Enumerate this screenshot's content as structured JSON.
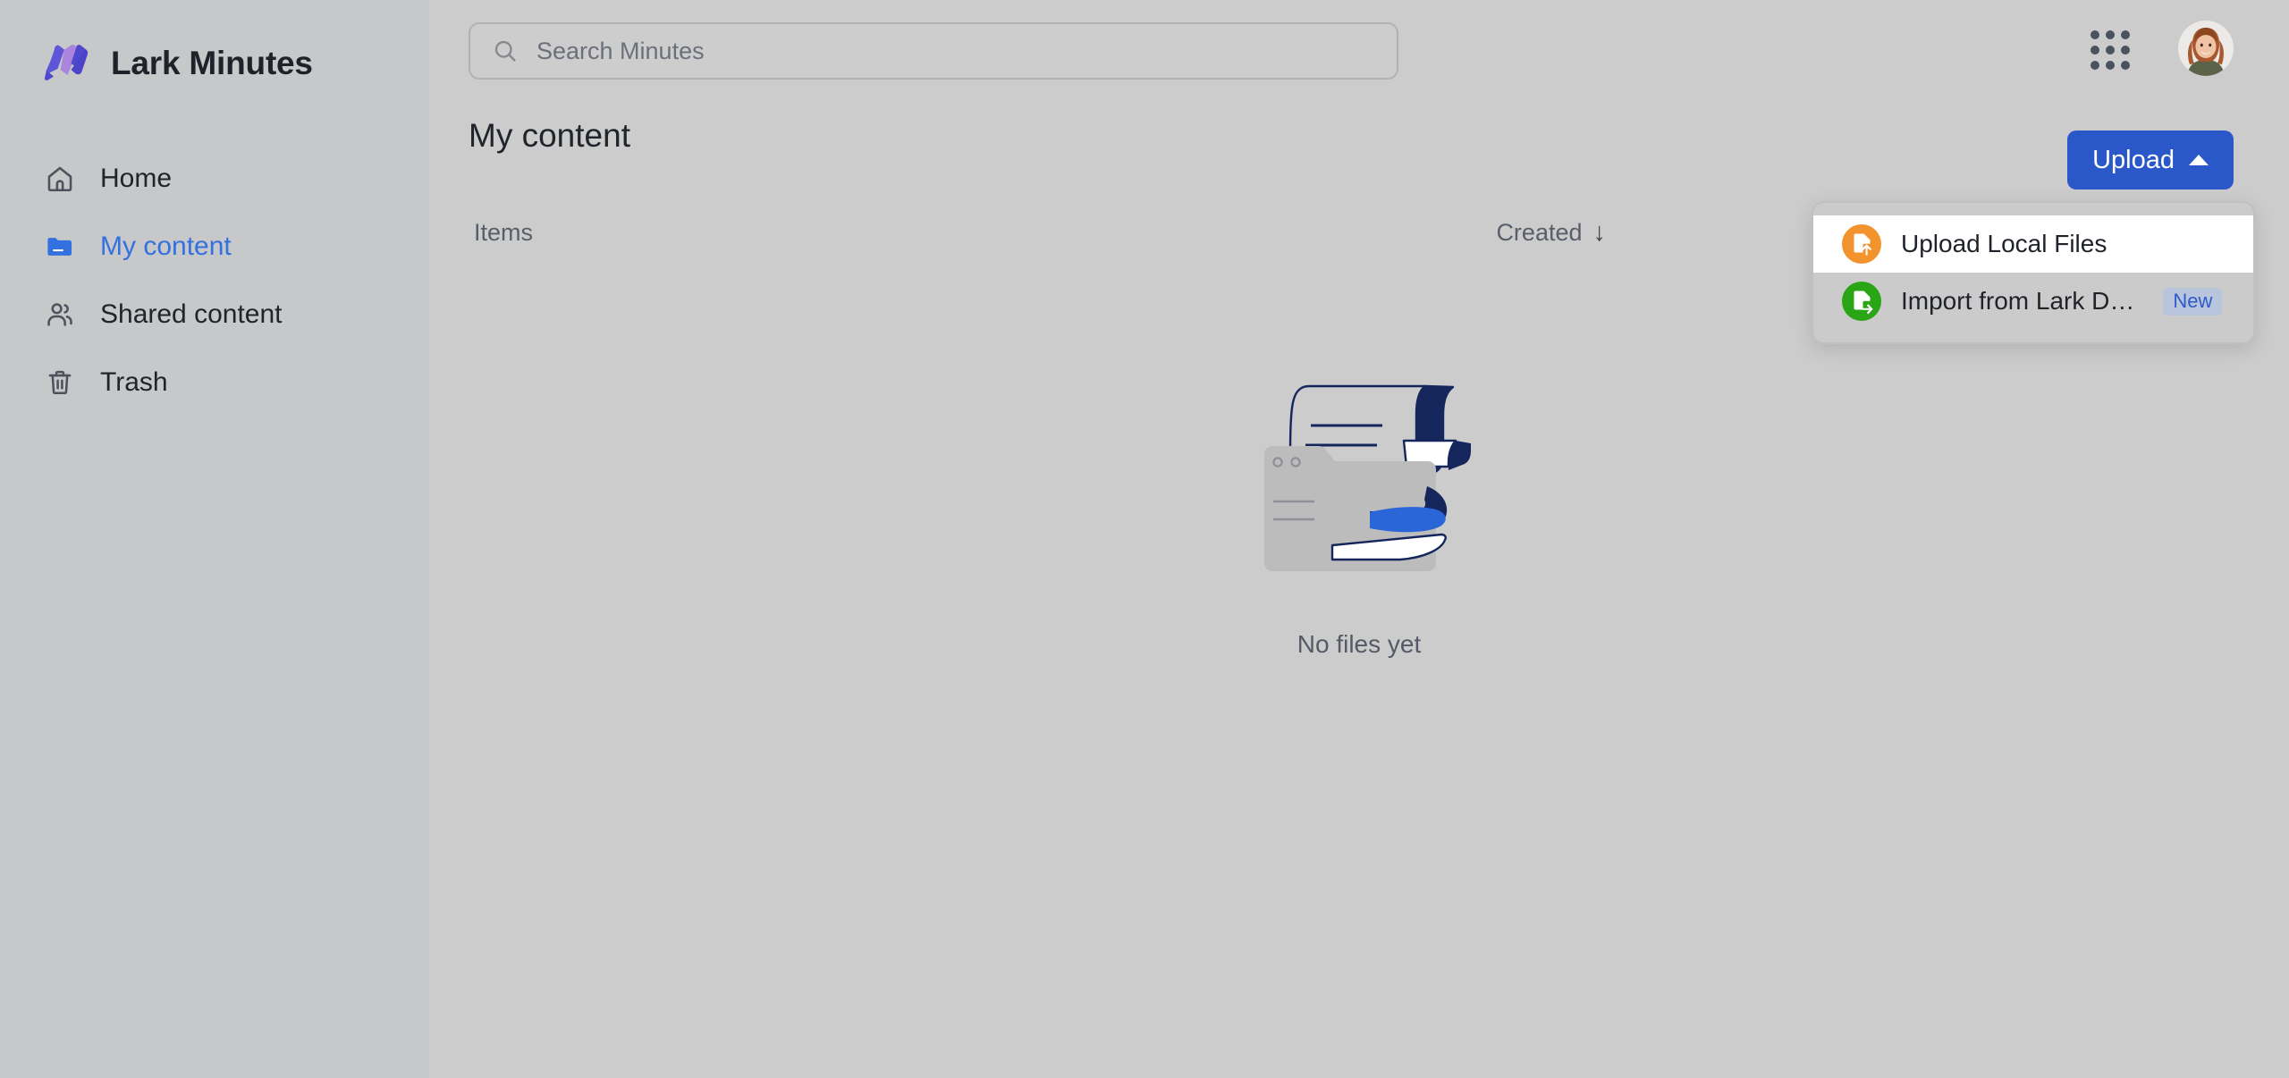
{
  "brand": {
    "name": "Lark Minutes",
    "logo_icon": "lark-minutes-logo",
    "logo_colors": [
      "#5a51d6",
      "#6e63e0",
      "#b388dd",
      "#4b42c4"
    ]
  },
  "search": {
    "placeholder": "Search Minutes",
    "value": "",
    "icon": "search-icon"
  },
  "topbar": {
    "app_launcher_icon": "grid-apps-icon",
    "avatar_icon": "user-avatar"
  },
  "sidebar": {
    "items": [
      {
        "label": "Home",
        "icon": "home-icon",
        "active": false
      },
      {
        "label": "My content",
        "icon": "folder-icon",
        "active": true
      },
      {
        "label": "Shared content",
        "icon": "people-icon",
        "active": false
      },
      {
        "label": "Trash",
        "icon": "trash-icon",
        "active": false
      }
    ]
  },
  "main": {
    "page_title": "My content",
    "table": {
      "columns": {
        "items": "Items",
        "created": "Created",
        "sort_arrow": "↓"
      },
      "rows": []
    },
    "empty_state": {
      "text": "No files yet",
      "illustration": "empty-documents-illustration"
    }
  },
  "upload": {
    "button_label": "Upload",
    "button_caret": "caret-up-icon",
    "button_color": "#2b58c9",
    "menu_open": true,
    "menu_items": [
      {
        "label": "Upload Local Files",
        "icon": "file-upload-icon",
        "icon_color": "#f2932e",
        "badge": "",
        "hovered": true
      },
      {
        "label": "Import from Lark D…",
        "icon": "file-import-icon",
        "icon_color": "#2aa515",
        "badge": "New",
        "hovered": false
      }
    ]
  }
}
